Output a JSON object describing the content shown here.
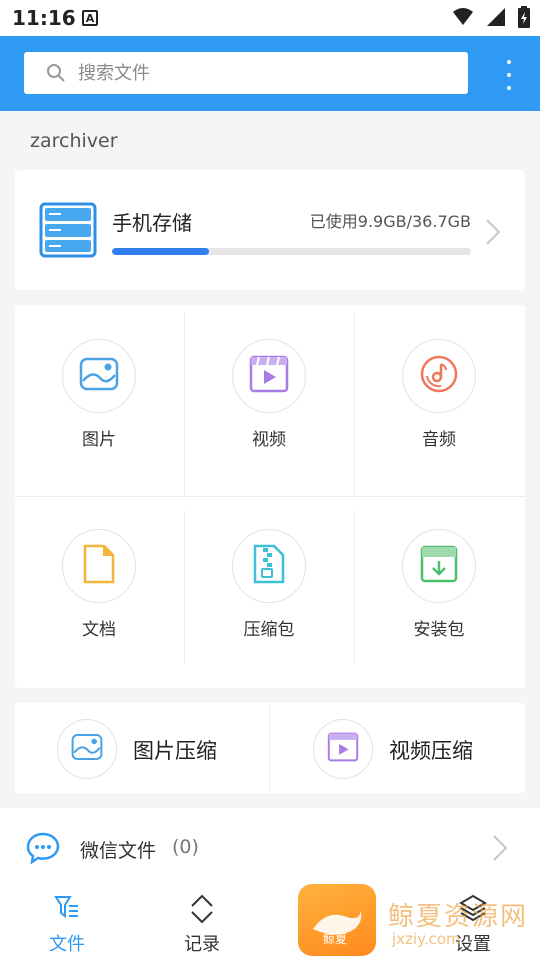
{
  "status_bar": {
    "time": "11:16",
    "notification_letter": "A"
  },
  "search": {
    "placeholder": "搜索文件"
  },
  "location": {
    "path": "zarchiver"
  },
  "storage": {
    "title": "手机存储",
    "usage_text": "已使用9.9GB/36.7GB",
    "used_fraction": 0.27
  },
  "categories": [
    {
      "label": "图片"
    },
    {
      "label": "视频"
    },
    {
      "label": "音频"
    },
    {
      "label": "文档"
    },
    {
      "label": "压缩包"
    },
    {
      "label": "安装包"
    }
  ],
  "compress": {
    "image_label": "图片压缩",
    "video_label": "视频压缩"
  },
  "wechat": {
    "label": "微信文件",
    "count": "(0)"
  },
  "bottom_nav": [
    {
      "label": "文件",
      "active": true
    },
    {
      "label": "记录",
      "active": false
    },
    {
      "label": "设置",
      "active": false
    }
  ],
  "watermark": {
    "logo_text": "鲸夏",
    "text": "鲸夏资源网",
    "url": "jxziy.com"
  },
  "colors": {
    "accent": "#2f9af3",
    "progress": "#2f7ff0",
    "image_icon": "#4aa3e6",
    "video_icon": "#a87ce6",
    "audio_icon": "#f0765a",
    "doc_icon": "#f5b53a",
    "archive_icon": "#3dbfd6",
    "apk_icon": "#4cbf6a"
  }
}
